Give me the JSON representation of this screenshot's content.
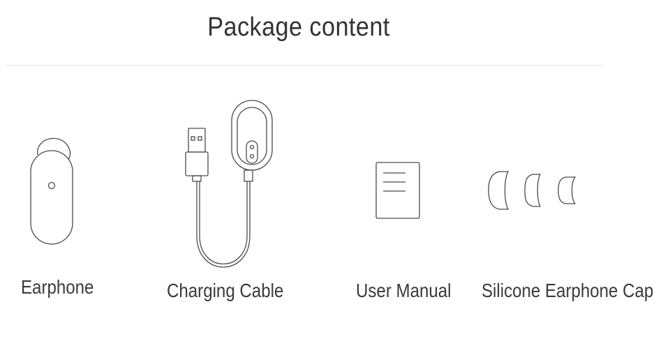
{
  "title": "Package content",
  "items": [
    {
      "label": "Earphone",
      "icon": "earphone-icon"
    },
    {
      "label": "Charging Cable",
      "icon": "charging-cable-icon"
    },
    {
      "label": "User Manual",
      "icon": "user-manual-icon"
    },
    {
      "label": "Silicone Earphone Cap",
      "icon": "silicone-earphone-cap-icon"
    }
  ],
  "colors": {
    "text": "#3a3a3a",
    "line": "#4a4a4a",
    "divider": "#e6e6e6",
    "background": "#ffffff"
  }
}
